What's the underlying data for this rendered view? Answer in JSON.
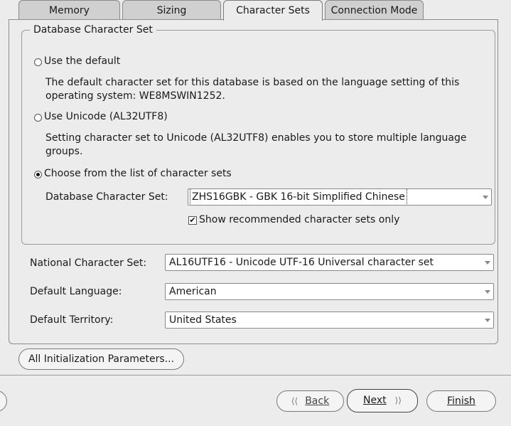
{
  "tabs": [
    {
      "label": "Memory"
    },
    {
      "label": "Sizing"
    },
    {
      "label": "Character Sets"
    },
    {
      "label": "Connection Mode"
    }
  ],
  "db_charset_group": {
    "title": "Database Character Set",
    "option_default": {
      "label": "Use the default",
      "description": "The default character set for this database is based on the language setting of this operating system: WE8MSWIN1252."
    },
    "option_unicode": {
      "label": "Use Unicode (AL32UTF8)",
      "description": "Setting character set to Unicode (AL32UTF8) enables you to store multiple language groups."
    },
    "option_choose": {
      "label": "Choose from the list of character sets"
    },
    "charset_label": "Database Character Set:",
    "charset_value": "ZHS16GBK - GBK 16-bit Simplified Chinese",
    "recommended_label": "Show recommended character sets only",
    "selected_option": "choose",
    "recommended_checked": true
  },
  "national_charset": {
    "label": "National Character Set:",
    "value": "AL16UTF16 - Unicode UTF-16 Universal character set"
  },
  "default_language": {
    "label": "Default Language:",
    "value": "American"
  },
  "default_territory": {
    "label": "Default Territory:",
    "value": "United States"
  },
  "buttons": {
    "all_params": "All Initialization Parameters...",
    "back": "Back",
    "next": "Next",
    "finish": "Finish"
  },
  "icons": {
    "back": "chevron-left-double-icon",
    "next": "chevron-right-double-icon"
  }
}
